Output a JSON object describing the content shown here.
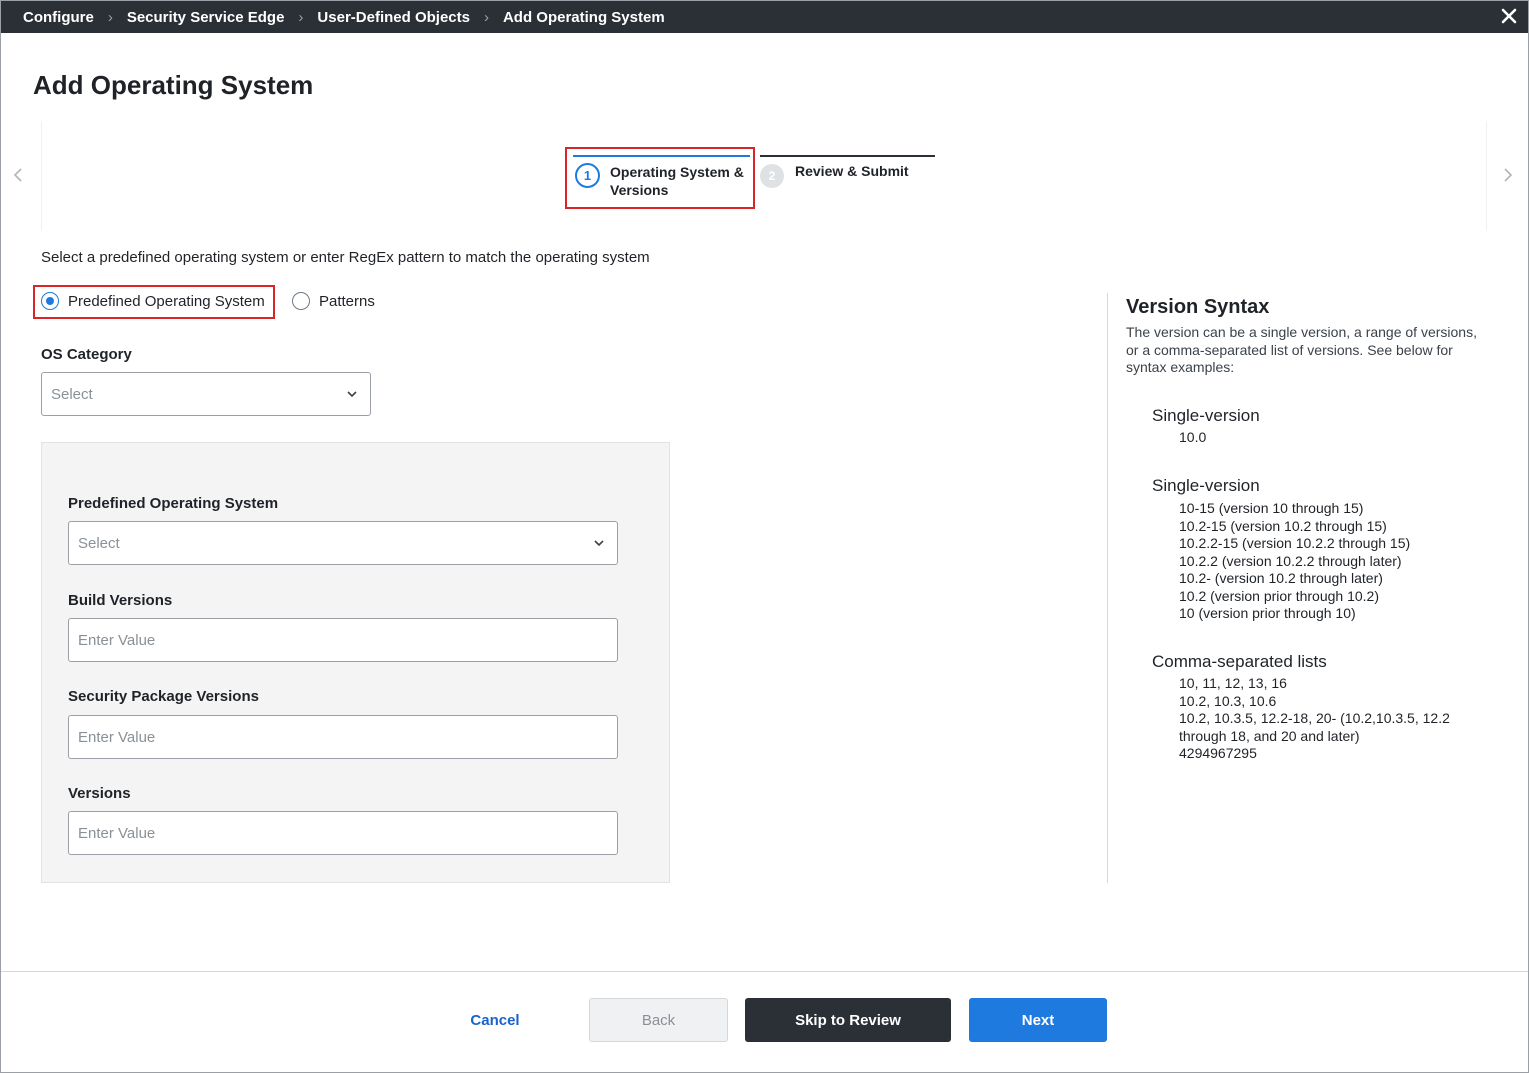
{
  "breadcrumb": {
    "items": [
      "Configure",
      "Security Service Edge",
      "User-Defined Objects",
      "Add Operating System"
    ]
  },
  "page": {
    "title": "Add Operating System"
  },
  "stepper": {
    "steps": [
      {
        "number": "1",
        "label": "Operating System & Versions"
      },
      {
        "number": "2",
        "label": "Review & Submit"
      }
    ]
  },
  "form": {
    "instruction": "Select a predefined operating system or enter RegEx pattern to match the operating system",
    "radios": [
      {
        "label": "Predefined Operating System",
        "checked": true
      },
      {
        "label": "Patterns",
        "checked": false
      }
    ],
    "os_category": {
      "label": "OS Category",
      "placeholder": "Select"
    },
    "predefined_os": {
      "label": "Predefined Operating System",
      "placeholder": "Select"
    },
    "build_versions": {
      "label": "Build Versions",
      "placeholder": "Enter Value"
    },
    "security_package_versions": {
      "label": "Security Package Versions",
      "placeholder": "Enter Value"
    },
    "versions": {
      "label": "Versions",
      "placeholder": "Enter Value"
    }
  },
  "version_syntax": {
    "title": "Version Syntax",
    "description": "The version can be a single version, a range of versions, or a comma-separated list of versions. See below for syntax examples:",
    "sections": [
      {
        "heading": "Single-version",
        "lines": [
          "10.0"
        ]
      },
      {
        "heading": "Single-version",
        "lines": [
          "10-15 (version 10 through 15)",
          "10.2-15 (version 10.2 through 15)",
          "10.2.2-15 (version 10.2.2 through 15)",
          "10.2.2 (version 10.2.2 through later)",
          "10.2- (version 10.2 through later)",
          "10.2 (version prior through 10.2)",
          "10 (version prior through 10)"
        ]
      },
      {
        "heading": "Comma-separated lists",
        "lines": [
          "10, 11, 12, 13, 16",
          "10.2, 10.3, 10.6",
          "10.2, 10.3.5, 12.2-18, 20- (10.2,10.3.5, 12.2",
          "through 18, and 20 and later)",
          "4294967295"
        ]
      }
    ]
  },
  "footer": {
    "cancel": "Cancel",
    "back": "Back",
    "skip": "Skip to Review",
    "next": "Next"
  },
  "colors": {
    "accent": "#1f7ae0",
    "dark": "#2b3036",
    "highlight": "#d9252a"
  }
}
